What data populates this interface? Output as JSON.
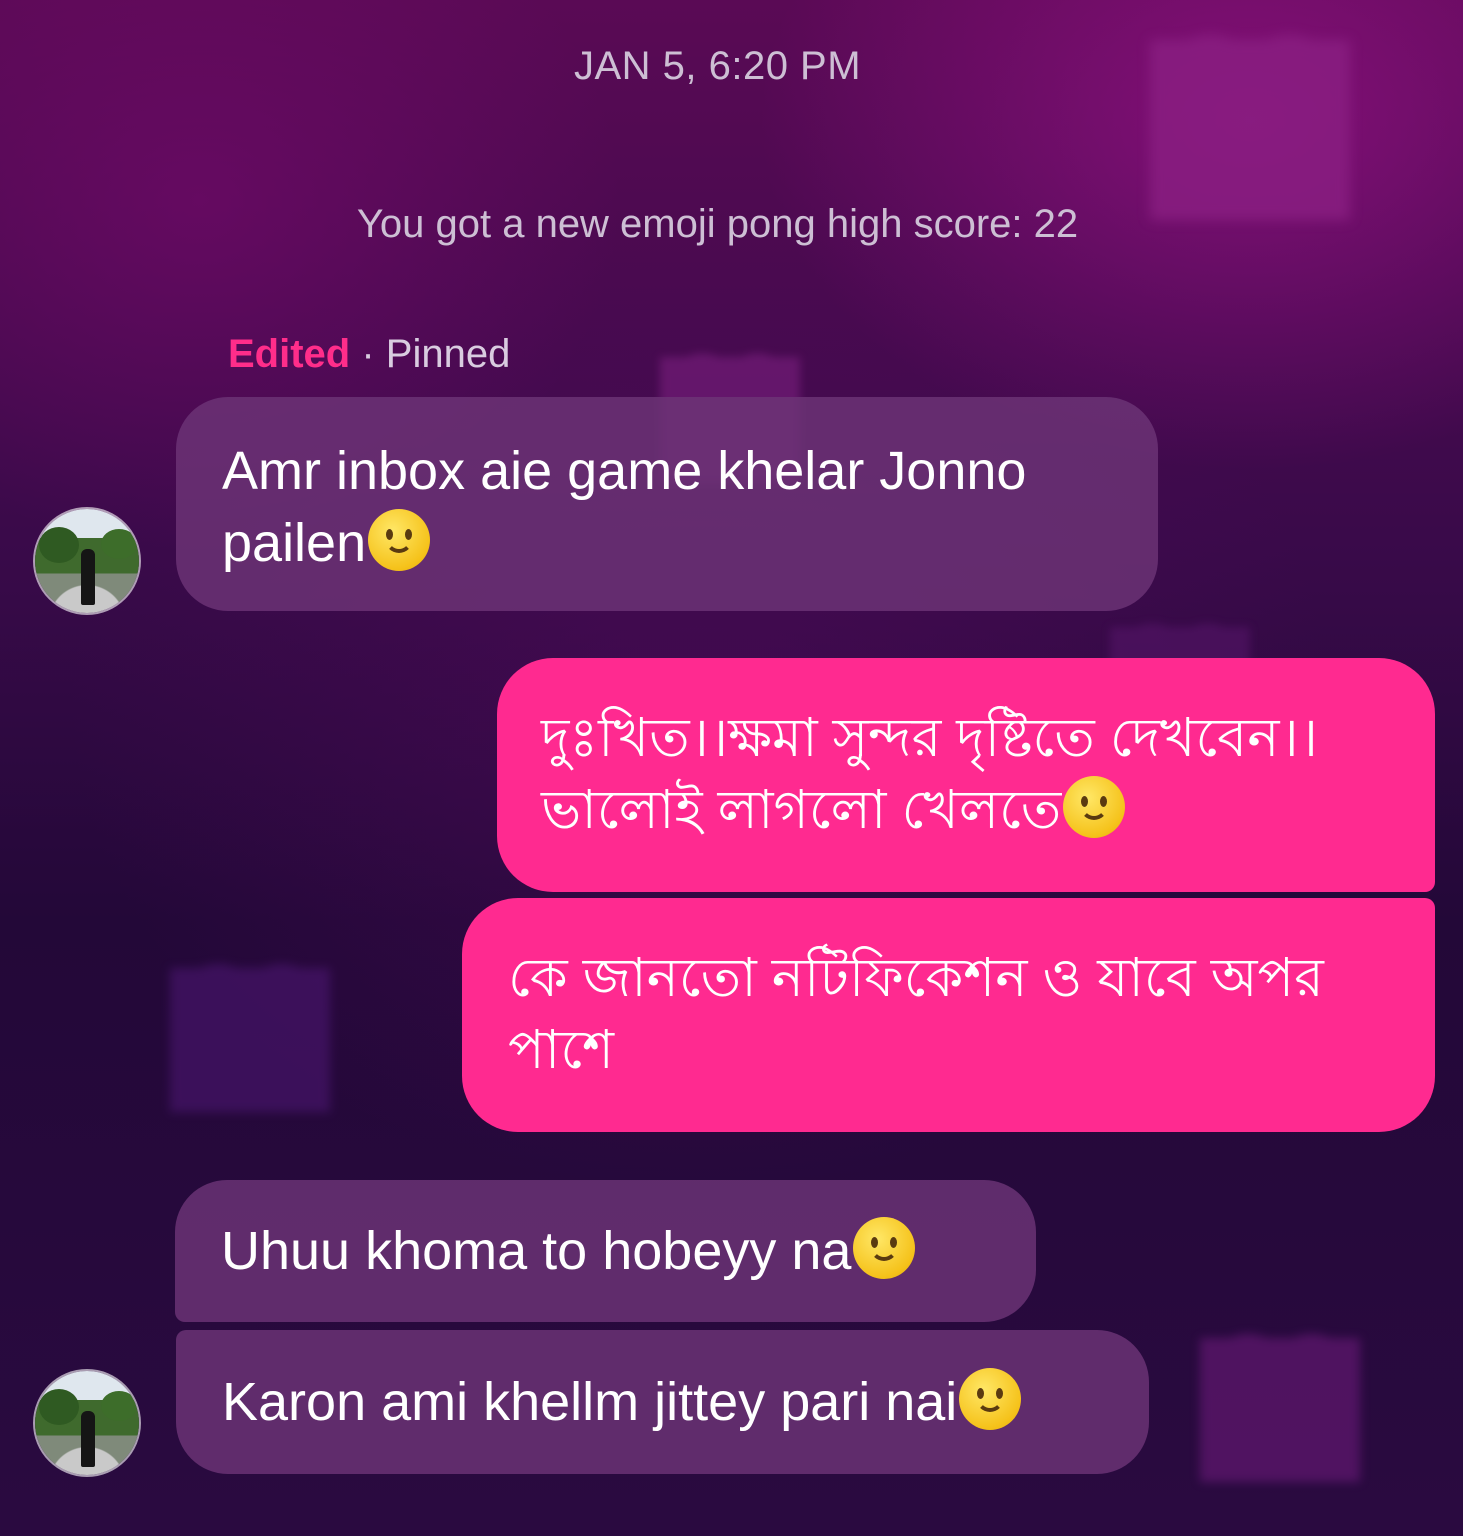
{
  "chat": {
    "timestamp": "JAN 5, 6:20 PM",
    "system_message": "You got a new emoji pong high score: 22",
    "meta": {
      "edited": "Edited",
      "separator": " · ",
      "pinned": "Pinned"
    },
    "messages": [
      {
        "sender": "other",
        "text": "Amr inbox aie game khelar Jonno pailen",
        "emoji": "slightly-smiling-face"
      },
      {
        "sender": "me",
        "text": "দুঃখিত।।ক্ষমা সুন্দর দৃষ্টিতে দেখবেন।। ভালোই লাগলো খেলতে",
        "emoji": "slightly-smiling-face"
      },
      {
        "sender": "me",
        "text": "কে জানতো নটিফিকেশন ও যাবে অপর পাশে",
        "emoji": ""
      },
      {
        "sender": "other",
        "text": "Uhuu khoma to hobeyy na",
        "emoji": "slightly-smiling-face"
      },
      {
        "sender": "other",
        "text": "Karon ami khellm jittey pari nai",
        "emoji": "slightly-smiling-face"
      }
    ]
  },
  "colors": {
    "incoming_bubble": "#6c3476",
    "outgoing_bubble": "#ff2a90",
    "edited_label": "#ff2d8a",
    "muted_text": "#cdbfd4"
  }
}
